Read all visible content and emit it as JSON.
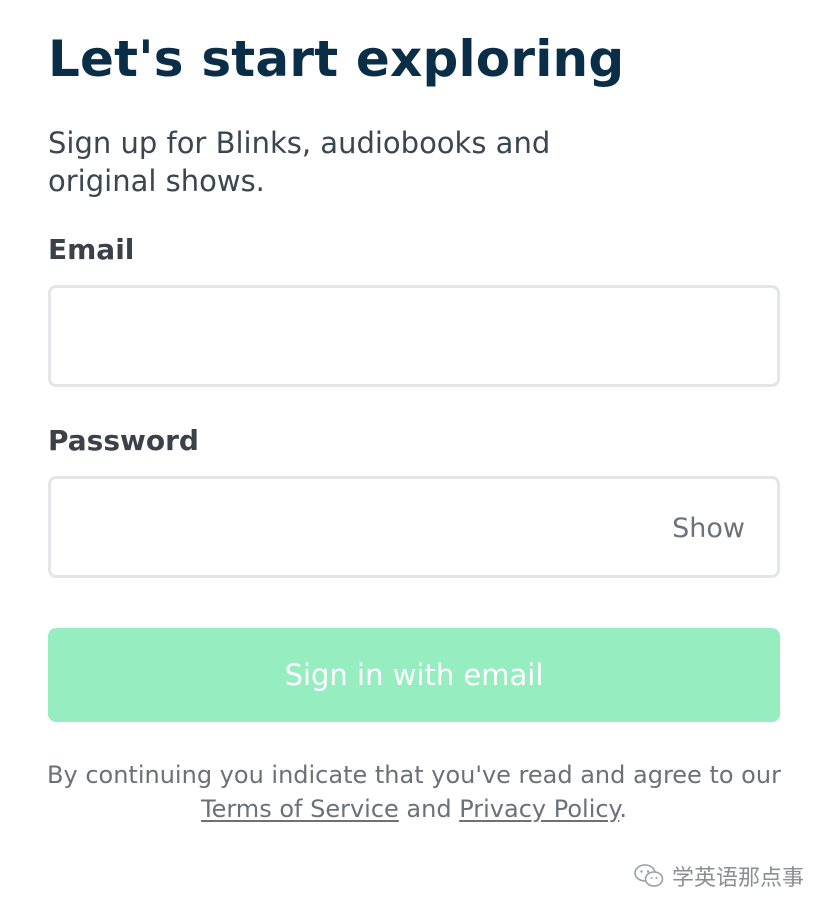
{
  "header": {
    "title": "Let's start exploring",
    "subtitle": "Sign up for Blinks, audiobooks and original shows."
  },
  "form": {
    "email": {
      "label": "Email",
      "value": "",
      "placeholder": ""
    },
    "password": {
      "label": "Password",
      "value": "",
      "placeholder": "",
      "toggle_label": "Show"
    },
    "submit_label": "Sign in with email"
  },
  "legal": {
    "prefix": "By continuing you indicate that you've read and agree to our ",
    "terms_label": "Terms of Service",
    "conjunction": " and ",
    "privacy_label": "Privacy Policy",
    "suffix": "."
  },
  "watermark": {
    "text": "学英语那点事",
    "icon": "wechat-icon"
  },
  "colors": {
    "title": "#0a2e47",
    "button_disabled": "#95edc0",
    "input_border": "#e3e6e8"
  }
}
